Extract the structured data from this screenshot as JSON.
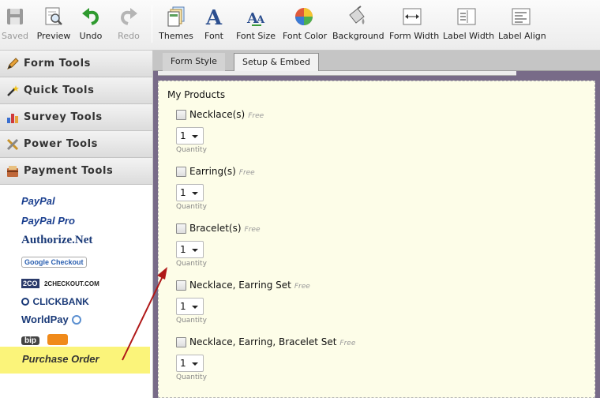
{
  "toolbar": {
    "buttons": [
      {
        "label": "Saved",
        "icon": "floppy-disk-icon",
        "disabled": true
      },
      {
        "label": "Preview",
        "icon": "preview-magnifier-icon",
        "disabled": false
      },
      {
        "label": "Undo",
        "icon": "undo-arrow-icon",
        "disabled": false
      },
      {
        "label": "Redo",
        "icon": "redo-arrow-icon",
        "disabled": true
      },
      {
        "label": "Themes",
        "icon": "themes-icon",
        "disabled": false
      },
      {
        "label": "Font",
        "icon": "font-icon",
        "disabled": false
      },
      {
        "label": "Font Size",
        "icon": "font-size-icon",
        "disabled": false
      },
      {
        "label": "Font Color",
        "icon": "font-color-icon",
        "disabled": false
      },
      {
        "label": "Background",
        "icon": "paint-bucket-icon",
        "disabled": false
      },
      {
        "label": "Form Width",
        "icon": "form-width-icon",
        "disabled": false
      },
      {
        "label": "Label Width",
        "icon": "label-width-icon",
        "disabled": false
      },
      {
        "label": "Label Align",
        "icon": "label-align-icon",
        "disabled": false
      }
    ]
  },
  "sidebar": {
    "categories": [
      {
        "label": "Form Tools",
        "icon": "pencil-icon"
      },
      {
        "label": "Quick Tools",
        "icon": "wand-icon"
      },
      {
        "label": "Survey Tools",
        "icon": "bar-chart-icon"
      },
      {
        "label": "Power Tools",
        "icon": "tools-icon"
      },
      {
        "label": "Payment Tools",
        "icon": "payment-icon"
      }
    ],
    "payments": [
      {
        "label": "PayPal",
        "icon": "paypal-logo"
      },
      {
        "label": "PayPal Pro",
        "icon": "paypal-pro-logo"
      },
      {
        "label": "Authorize.Net",
        "icon": "authorize-net-logo"
      },
      {
        "label": "Google Checkout",
        "icon": "google-checkout-logo"
      },
      {
        "label": "2CHECKOUT.COM",
        "icon": "2checkout-logo"
      },
      {
        "label": "CLICKBANK",
        "icon": "clickbank-logo"
      },
      {
        "label": "WorldPay",
        "icon": "worldpay-logo"
      },
      {
        "label": "bip",
        "icon": "bip-logo"
      }
    ],
    "purchase_order": "Purchase Order"
  },
  "tabs": [
    "Form Style",
    "Setup & Embed"
  ],
  "form": {
    "title": "My Products",
    "free_label": "Free",
    "quantity_label": "Quantity",
    "products": [
      {
        "name": "Necklace(s)",
        "quantity": "1"
      },
      {
        "name": "Earring(s)",
        "quantity": "1"
      },
      {
        "name": "Bracelet(s)",
        "quantity": "1"
      },
      {
        "name": "Necklace, Earring Set",
        "quantity": "1"
      },
      {
        "name": "Necklace, Earring, Bracelet Set",
        "quantity": "1"
      }
    ]
  },
  "colors": {
    "highlight": "#fbf47a",
    "arrow": "#b01818",
    "form_bg": "#fdfde8",
    "canvas_bg": "#786b88"
  }
}
